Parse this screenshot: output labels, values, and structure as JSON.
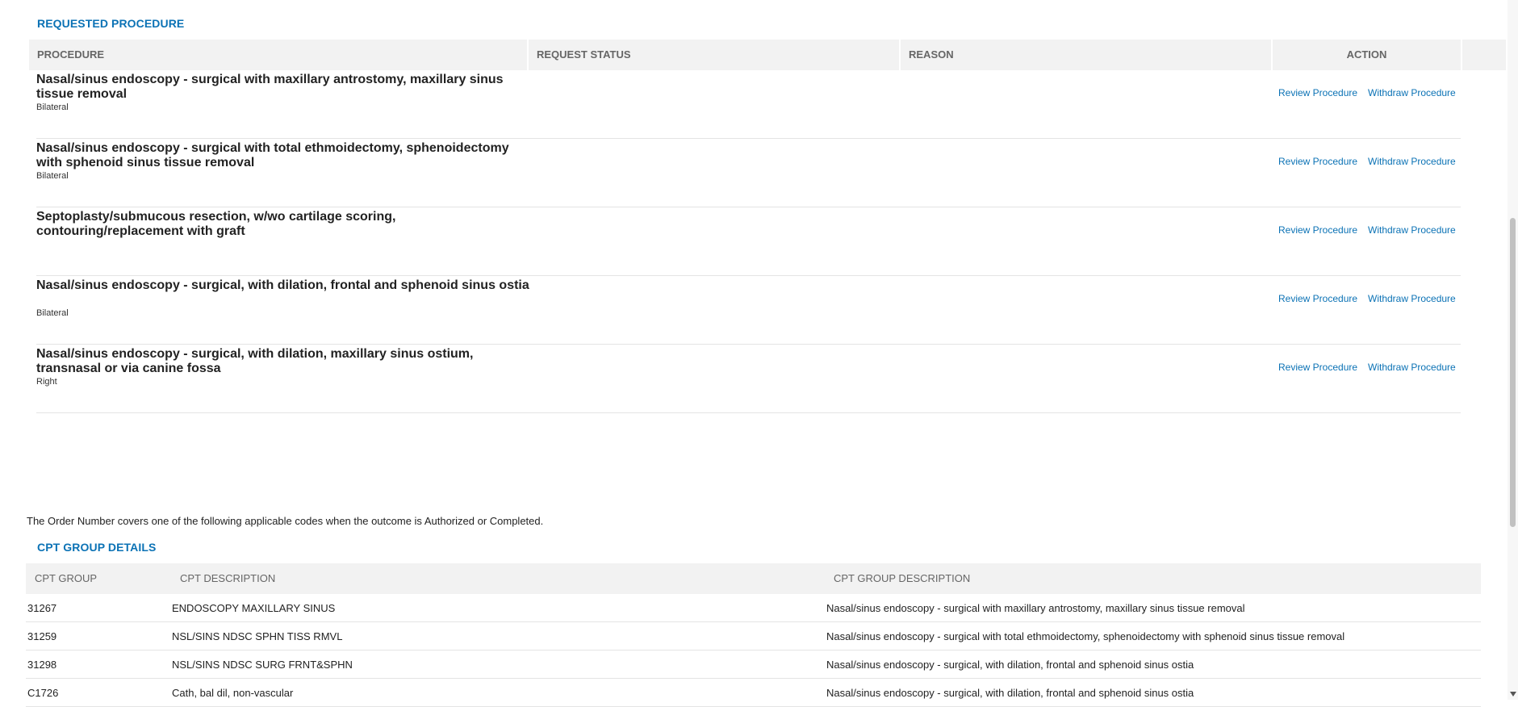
{
  "requested_procedure": {
    "title": "REQUESTED PROCEDURE",
    "columns": {
      "procedure": "PROCEDURE",
      "request_status": "REQUEST STATUS",
      "reason": "REASON",
      "action": "ACTION"
    },
    "rows": [
      {
        "name": "Nasal/sinus endoscopy - surgical with maxillary antrostomy, maxillary sinus tissue removal",
        "side": "Bilateral",
        "review": "Review Procedure",
        "withdraw": "Withdraw Procedure"
      },
      {
        "name": "Nasal/sinus endoscopy - surgical with total ethmoidectomy, sphenoidectomy with sphenoid sinus tissue removal",
        "side": "Bilateral",
        "review": "Review Procedure",
        "withdraw": "Withdraw Procedure"
      },
      {
        "name": "Septoplasty/submucous resection, w/wo cartilage scoring, contouring/replacement with graft",
        "side": "",
        "review": "Review Procedure",
        "withdraw": "Withdraw Procedure"
      },
      {
        "name": "Nasal/sinus endoscopy - surgical, with dilation, frontal and sphenoid sinus ostia",
        "side": "Bilateral",
        "review": "Review Procedure",
        "withdraw": "Withdraw Procedure"
      },
      {
        "name": "Nasal/sinus endoscopy - surgical, with dilation, maxillary sinus ostium, transnasal or via canine fossa",
        "side": "Right",
        "review": "Review Procedure",
        "withdraw": "Withdraw Procedure"
      }
    ]
  },
  "cpt_info": "The Order Number covers one of the following applicable codes when the outcome is Authorized or Completed.",
  "cpt_group_details": {
    "title": "CPT GROUP DETAILS",
    "columns": {
      "group": "CPT GROUP",
      "description": "CPT DESCRIPTION",
      "group_description": "CPT GROUP DESCRIPTION"
    },
    "rows": [
      {
        "group": "31267",
        "description": "ENDOSCOPY MAXILLARY SINUS",
        "group_description": "Nasal/sinus endoscopy - surgical with maxillary antrostomy, maxillary sinus tissue removal"
      },
      {
        "group": "31259",
        "description": "NSL/SINS NDSC SPHN TISS RMVL",
        "group_description": "Nasal/sinus endoscopy - surgical with total ethmoidectomy, sphenoidectomy with sphenoid sinus tissue removal"
      },
      {
        "group": "31298",
        "description": "NSL/SINS NDSC SURG FRNT&SPHN",
        "group_description": "Nasal/sinus endoscopy - surgical, with dilation, frontal and sphenoid sinus ostia"
      },
      {
        "group": "C1726",
        "description": "Cath, bal dil, non-vascular",
        "group_description": "Nasal/sinus endoscopy - surgical, with dilation, frontal and sphenoid sinus ostia"
      }
    ]
  },
  "colors": {
    "accent": "#0b72b5",
    "header_bg": "#f2f2f2",
    "header_text": "#666666"
  }
}
